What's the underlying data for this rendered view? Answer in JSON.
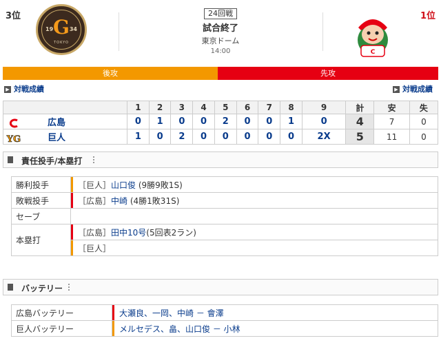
{
  "header": {
    "home_rank": "3位",
    "away_rank": "1位",
    "game_no": "24回戦",
    "result": "試合終了",
    "stadium": "東京ドーム",
    "time": "14:00",
    "home_side": "後攻",
    "away_side": "先攻",
    "home_logo": {
      "year_left": "19",
      "year_right": "34",
      "letter": "G",
      "text": "TOKYO"
    },
    "colors": {
      "home": "#f39800",
      "away": "#e60012",
      "link": "#0a3c8c"
    }
  },
  "links": {
    "left": "対戦成績",
    "right": "対戦成績"
  },
  "scoreboard": {
    "headers": [
      "",
      "1",
      "2",
      "3",
      "4",
      "5",
      "6",
      "7",
      "8",
      "9",
      "計",
      "安",
      "失"
    ],
    "rows": [
      {
        "team": "広島",
        "innings": [
          "0",
          "1",
          "0",
          "0",
          "2",
          "0",
          "0",
          "1",
          "0"
        ],
        "total": "4",
        "hits": "7",
        "errors": "0"
      },
      {
        "team": "巨人",
        "innings": [
          "1",
          "0",
          "2",
          "0",
          "0",
          "0",
          "0",
          "0",
          "2X"
        ],
        "total": "5",
        "hits": "11",
        "errors": "0"
      }
    ]
  },
  "pitchers": {
    "title": "責任投手/本塁打",
    "rows": [
      {
        "label": "勝利投手",
        "lines": [
          {
            "team": "［巨人］",
            "player": "山口俊",
            "note": "(9勝9敗1S)",
            "color": "#f39800"
          }
        ]
      },
      {
        "label": "敗戦投手",
        "lines": [
          {
            "team": "［広島］",
            "player": "中崎",
            "note": "(4勝1敗31S)",
            "color": "#e60012"
          }
        ]
      },
      {
        "label": "セーブ",
        "lines": []
      },
      {
        "label": "本塁打",
        "lines": [
          {
            "team": "［広島］",
            "player": "田中10号",
            "note": "(5回表2ラン)",
            "color": "#e60012"
          },
          {
            "team": "［巨人］",
            "player": "",
            "note": "",
            "color": "#f39800"
          }
        ]
      }
    ]
  },
  "battery": {
    "title": "バッテリー",
    "rows": [
      {
        "label": "広島バッテリー",
        "value": "大瀬良、一岡、中崎 － 會澤",
        "color": "#e60012"
      },
      {
        "label": "巨人バッテリー",
        "value": "メルセデス、畠、山口俊 － 小林",
        "color": "#f39800"
      }
    ]
  }
}
